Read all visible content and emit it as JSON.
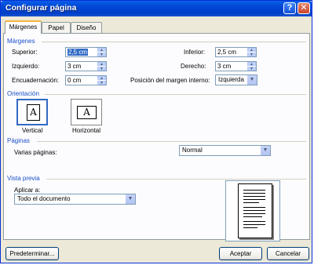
{
  "window": {
    "title": "Configurar página"
  },
  "titlebar": {
    "help_label": "?",
    "close_label": "✕"
  },
  "tabs": [
    {
      "label": "Márgenes",
      "active": true
    },
    {
      "label": "Papel",
      "active": false
    },
    {
      "label": "Diseño",
      "active": false
    }
  ],
  "margins": {
    "heading": "Márgenes",
    "superior": {
      "label": "Superior:",
      "value": "2,5 cm"
    },
    "inferior": {
      "label": "Inferior:",
      "value": "2,5 cm"
    },
    "izquierdo": {
      "label": "Izquierdo:",
      "value": "3 cm"
    },
    "derecho": {
      "label": "Derecho:",
      "value": "3 cm"
    },
    "encuadernacion": {
      "label": "Encuadernación:",
      "value": "0 cm"
    },
    "posicion": {
      "label": "Posición del margen interno:",
      "value": "Izquierda"
    }
  },
  "orientation": {
    "heading": "Orientación",
    "vertical": {
      "label": "Vertical",
      "glyph": "A",
      "selected": true
    },
    "horizontal": {
      "label": "Horizontal",
      "glyph": "A",
      "selected": false
    }
  },
  "pages": {
    "heading": "Páginas",
    "varias_label": "Varias páginas:",
    "varias_value": "Normal"
  },
  "preview": {
    "heading": "Vista previa",
    "apply_label": "Aplicar a:",
    "apply_value": "Todo el documento"
  },
  "buttons": {
    "default_label": "Predeterminar...",
    "accept_label": "Aceptar",
    "cancel_label": "Cancelar"
  },
  "colors": {
    "titlebar": "#0046d5",
    "group_heading": "#1a4fc8",
    "selection": "#316ac5"
  }
}
